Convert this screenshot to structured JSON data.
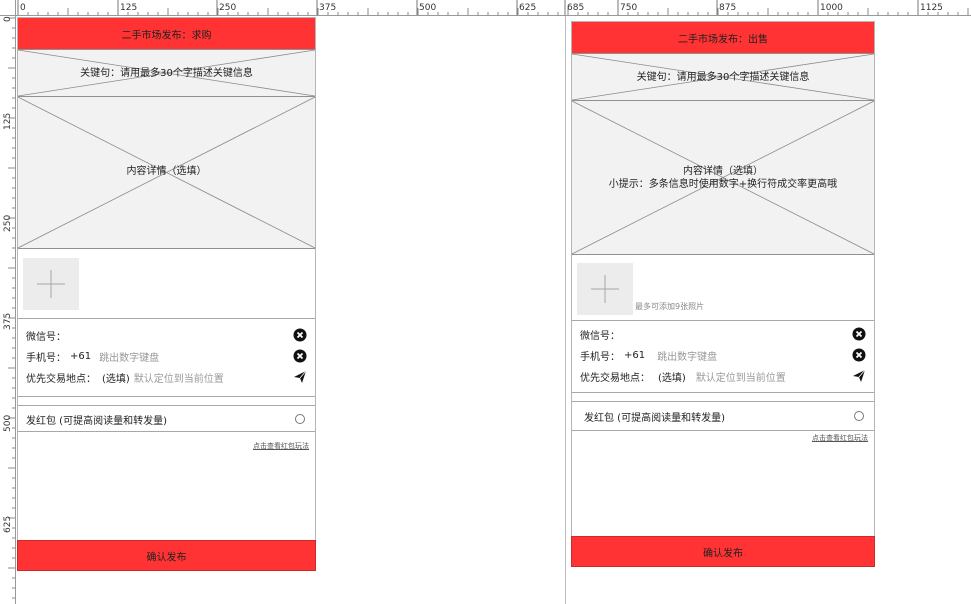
{
  "ruler": {
    "labels": [
      "0",
      "125",
      "250",
      "375",
      "500",
      "625",
      "685",
      "750",
      "875",
      "1000",
      "1125"
    ],
    "left_labels": [
      "0",
      "125",
      "250",
      "375",
      "500",
      "625"
    ]
  },
  "left_screen": {
    "title": "二手市场发布：求购",
    "keyword_placeholder": "关键句：请用最多30个字描述关键信息",
    "detail_placeholder": "内容详情（选填）",
    "wechat_label": "微信号：",
    "phone_label": "手机号：",
    "phone_prefix": "+61",
    "phone_hint": "跳出数字键盘",
    "location_label": "优先交易地点：",
    "location_optional": "(选填)",
    "location_hint": "默认定位到当前位置",
    "redpacket_label": "发红包 (可提高阅读量和转发量)",
    "redpacket_link": "点击查看红包玩法",
    "submit_label": "确认发布"
  },
  "right_screen": {
    "title": "二手市场发布：出售",
    "keyword_placeholder": "关键句：请用最多30个字描述关键信息",
    "detail_placeholder": "内容详情（选填）",
    "detail_tip": "小提示：多条信息时使用数字+换行符成交率更高哦",
    "photo_hint": "最多可添加9张照片",
    "wechat_label": "微信号：",
    "phone_label": "手机号：",
    "phone_prefix": "+61",
    "phone_hint": "跳出数字键盘",
    "location_label": "优先交易地点：",
    "location_optional": "(选填)",
    "location_hint": "默认定位到当前位置",
    "redpacket_label": "发红包 (可提高阅读量和转发量)",
    "redpacket_link": "点击查看红包玩法",
    "submit_label": "确认发布"
  },
  "colors": {
    "accent_red": "#ff3333",
    "placeholder_gray": "#f2f2f2",
    "hint_gray": "#999999"
  },
  "icons": [
    "close-circle-icon",
    "send-arrow-icon",
    "plus-icon",
    "radio-icon"
  ]
}
